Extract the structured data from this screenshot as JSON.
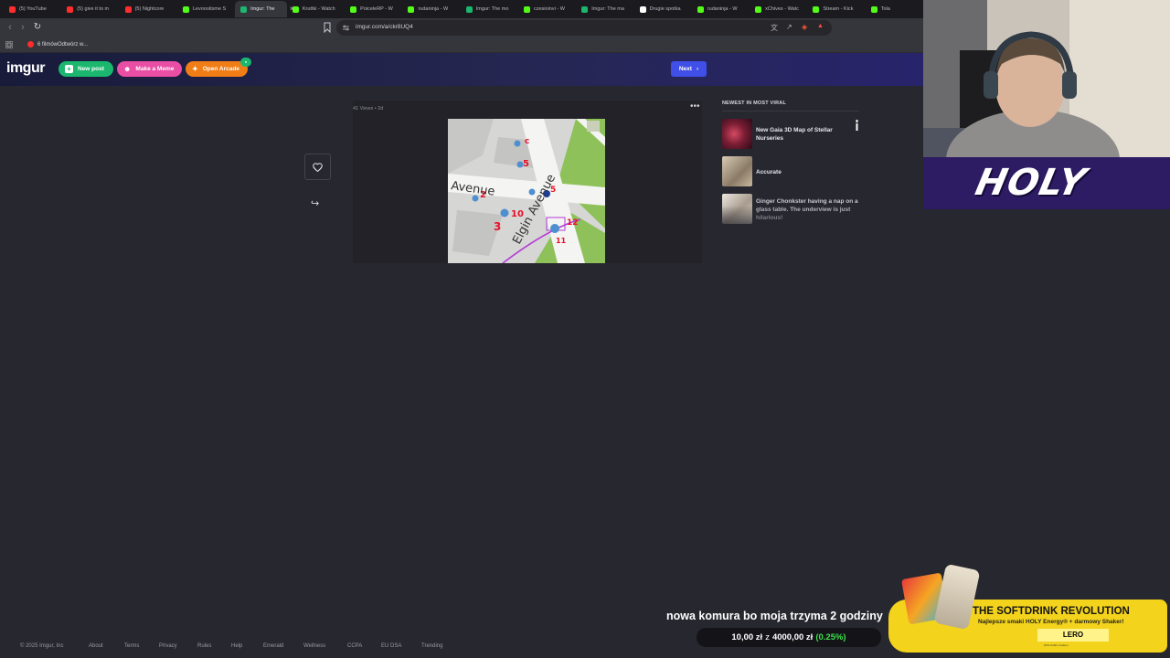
{
  "browser": {
    "tabs": [
      {
        "label": "(5) YouTube",
        "color": "#ff2d2d"
      },
      {
        "label": "(5) give it to m",
        "color": "#ff2d2d"
      },
      {
        "label": "(5) Nightcore",
        "color": "#ff2d2d"
      },
      {
        "label": "Levoooitsme S",
        "color": "#53fc18"
      },
      {
        "label": "Imgur: The",
        "color": "#1bb76e",
        "active": true
      },
      {
        "label": "Kruttki - Watch",
        "color": "#53fc18"
      },
      {
        "label": "PoiceleRP - W",
        "color": "#53fc18"
      },
      {
        "label": "rudaninja - W",
        "color": "#53fc18"
      },
      {
        "label": "Imgur: The mo",
        "color": "#1bb76e"
      },
      {
        "label": "czesioinvi - W",
        "color": "#53fc18"
      },
      {
        "label": "Imgur: The ma",
        "color": "#1bb76e"
      },
      {
        "label": "Drugie spotka",
        "color": "#ffffff"
      },
      {
        "label": "rudaninja - W",
        "color": "#53fc18"
      },
      {
        "label": "xChives - Watc",
        "color": "#53fc18"
      },
      {
        "label": "Stream - Kick",
        "color": "#53fc18"
      },
      {
        "label": "Tola",
        "color": "#53fc18"
      }
    ],
    "url": "imgur.com/a/ckr8UQ4",
    "bookmark": "6 filmówOdtwórz w..."
  },
  "header": {
    "logo": "imgur",
    "new_post": "New post",
    "make_meme": "Make a Meme",
    "open_arcade": "Open Arcade",
    "next": "Next"
  },
  "post": {
    "meta": "41 Views • 2d",
    "more": "•••",
    "map_labels": [
      "Avenue",
      "Elgin Avenue"
    ]
  },
  "sidebar": {
    "title": "NEWEST IN MOST VIRAL",
    "items": [
      {
        "title": "New Gaia 3D Map of Stellar Nurseries"
      },
      {
        "title": "Accurate"
      },
      {
        "title": "Ginger Chonkster having a nap on a glass table. The underview is just hilarious!"
      }
    ]
  },
  "footer": {
    "copyright": "© 2025 Imgur, Inc",
    "links": [
      "About",
      "Terms",
      "Privacy",
      "Rules",
      "Help",
      "Emerald",
      "Wellness",
      "CCPA",
      "EU DSA",
      "Trending"
    ]
  },
  "stream": {
    "holy": "HOLY",
    "ticker": "nowa komura bo moja trzyma 2 godziny",
    "donate_amount": "10,00 zł",
    "donate_of": "z",
    "donate_goal": "4000,00 zł",
    "donate_pct": "(0.25%)",
    "ad_title": "THE SOFTDRINK REVOLUTION",
    "ad_sub": "Najlepsze smaki HOLY Energy® + darmowy Shaker!",
    "ad_code": "LERO",
    "ad_fine": "10% zniżki z kodem"
  },
  "colors": {
    "imgur_green": "#1bb76e",
    "imgur_pink": "#e94ea5",
    "imgur_orange": "#f07d16",
    "next_blue": "#3f4fe8",
    "holy_purple": "#2d1b63",
    "ad_yellow": "#f3d31b"
  }
}
